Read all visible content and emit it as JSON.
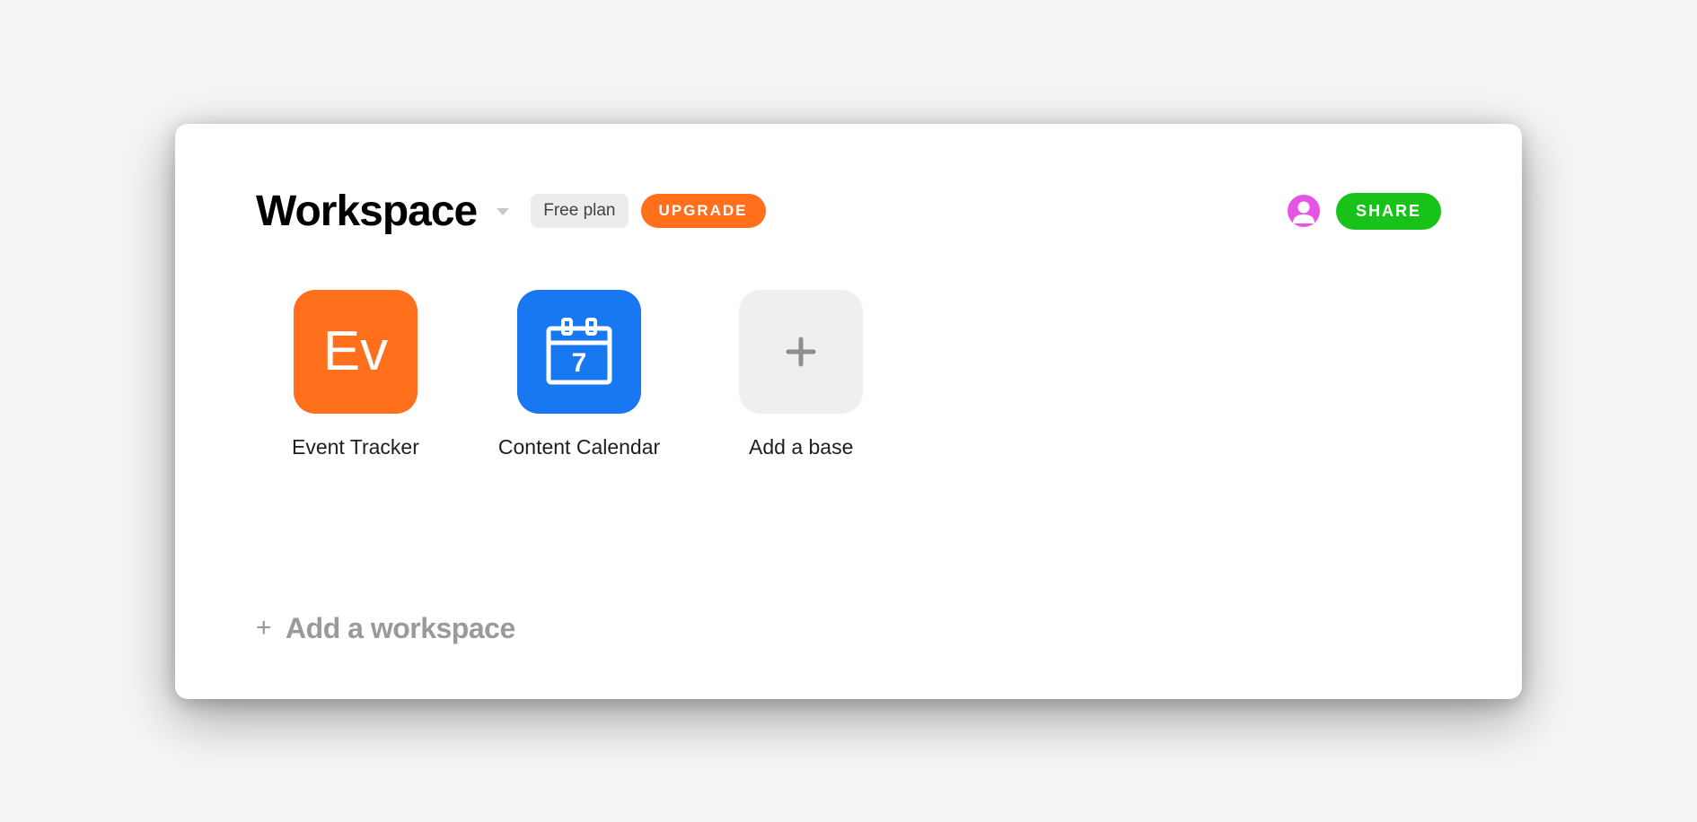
{
  "header": {
    "title": "Workspace",
    "plan_label": "Free plan",
    "upgrade_label": "UPGRADE",
    "share_label": "SHARE"
  },
  "bases": [
    {
      "label": "Event Tracker",
      "icon_text": "Ev",
      "icon_type": "text",
      "bg": "orange"
    },
    {
      "label": "Content Calendar",
      "icon_type": "calendar",
      "calendar_number": "7",
      "bg": "blue"
    },
    {
      "label": "Add a base",
      "icon_type": "plus",
      "bg": "gray"
    }
  ],
  "footer": {
    "add_workspace_label": "Add a workspace"
  }
}
